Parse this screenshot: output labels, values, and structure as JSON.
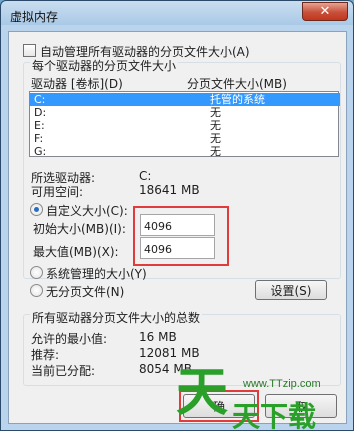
{
  "window": {
    "title": "虚拟内存",
    "close_label": "✕"
  },
  "auto_manage": {
    "label": "自动管理所有驱动器的分页文件大小(A)",
    "checked": false
  },
  "section_each": {
    "title": "每个驱动器的分页文件大小"
  },
  "columns": {
    "drive": "驱动器 [卷标](D)",
    "size": "分页文件大小(MB)"
  },
  "drives": [
    {
      "drive": "C:",
      "size": "托管的系统",
      "selected": true
    },
    {
      "drive": "D:",
      "size": "无"
    },
    {
      "drive": "E:",
      "size": "无"
    },
    {
      "drive": "F:",
      "size": "无"
    },
    {
      "drive": "G:",
      "size": "无"
    }
  ],
  "info": {
    "selected_label": "所选驱动器:",
    "selected_value": "C:",
    "free_label": "可用空间:",
    "free_value": "18641 MB"
  },
  "custom": {
    "label": "自定义大小(C):",
    "selected": true
  },
  "initial": {
    "label": "初始大小(MB)(I):",
    "value": "4096"
  },
  "max": {
    "label": "最大值(MB)(X):",
    "value": "4096"
  },
  "system_managed": {
    "label": "系统管理的大小(Y)"
  },
  "no_paging": {
    "label": "无分页文件(N)"
  },
  "set_button": "设置(S)",
  "total": {
    "title": "所有驱动器分页文件大小的总数",
    "min_label": "允许的最小值:",
    "min_value": "16 MB",
    "recommended_label": "推荐:",
    "recommended_value": "12081 MB",
    "current_label": "当前已分配:",
    "current_value": "8054 MB"
  },
  "ok_button": "确",
  "cancel_button": "取",
  "watermark": {
    "char1": "天",
    "char2": "天下载",
    "url": "www.TTzip.com"
  },
  "colors": {
    "selection": "#3399ff",
    "highlight_box": "#e23b3b",
    "close": "#c7503a"
  }
}
